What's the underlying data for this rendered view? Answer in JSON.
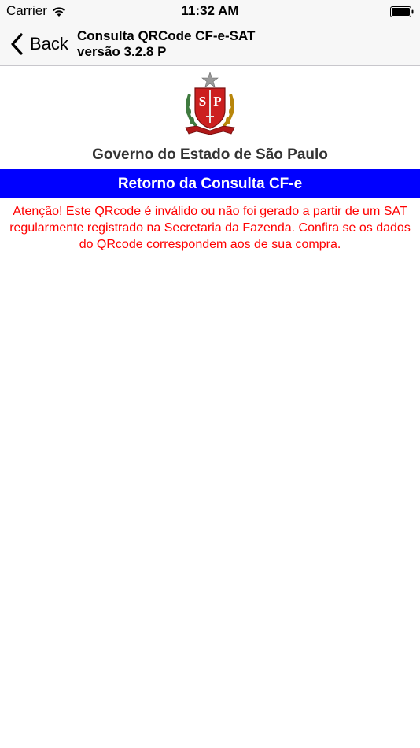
{
  "status_bar": {
    "carrier": "Carrier",
    "time": "11:32 AM",
    "wifi_icon": "wifi-icon",
    "battery_icon": "battery-icon"
  },
  "nav": {
    "back_label": "Back",
    "back_icon": "chevron-left-icon",
    "title_line1": "Consulta QRCode CF-e-SAT",
    "title_line2": "versão 3.2.8 P"
  },
  "header": {
    "seal_icon": "sao-paulo-coat-of-arms",
    "seal_text": "SP",
    "gov_title": "Governo do Estado de São Paulo"
  },
  "banner": {
    "label": "Retorno da Consulta CF-e",
    "color": "#0000ff"
  },
  "message": {
    "text": "Atenção! Este QRcode é inválido ou não foi gerado a partir de um SAT regularmente registrado na Secretaria da Fazenda. Confira se os dados do QRcode correspondem aos de sua compra.",
    "color": "#ff0000"
  }
}
